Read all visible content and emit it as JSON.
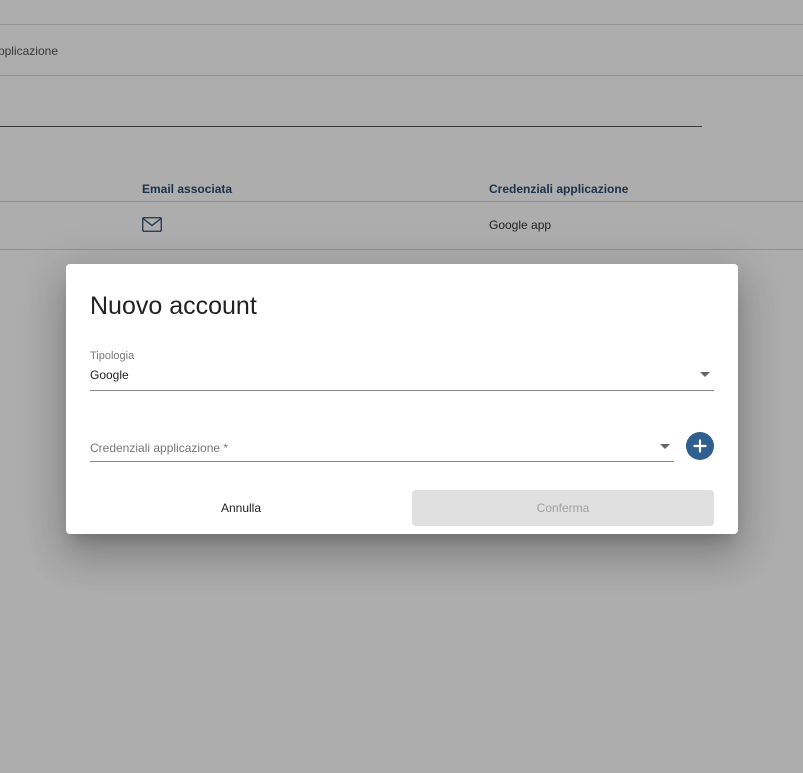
{
  "background": {
    "tab_label": "applicazione",
    "table": {
      "headers": [
        "Email associata",
        "Credenziali applicazione"
      ],
      "rows": [
        {
          "email_icon": "mail-icon",
          "credentials": "Google app"
        }
      ]
    }
  },
  "dialog": {
    "title": "Nuovo account",
    "type_field": {
      "label": "Tipologia",
      "value": "Google"
    },
    "credentials_field": {
      "placeholder": "Credenziali applicazione *"
    },
    "add_button_icon": "plus-icon",
    "cancel_label": "Annulla",
    "confirm_label": "Conferma"
  },
  "colors": {
    "accent": "#2f5f8f",
    "header_text": "#2c4a72",
    "overlay": "rgba(0,0,0,0.32)",
    "disabled_button": "#e0e0e0"
  }
}
